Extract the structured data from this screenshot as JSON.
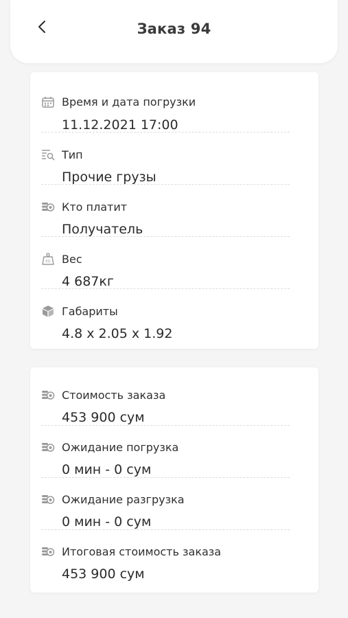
{
  "header": {
    "title": "Заказ 94",
    "back_icon": "chevron-left-icon"
  },
  "details": [
    {
      "icon": "calendar-icon",
      "label": "Время и дата погрузки",
      "value": "11.12.2021 17:00"
    },
    {
      "icon": "list-search-icon",
      "label": "Тип",
      "value": "Прочие грузы"
    },
    {
      "icon": "coins-icon",
      "label": "Кто платит",
      "value": "Получатель"
    },
    {
      "icon": "weight-icon",
      "label": "Вес",
      "value": "4 687кг"
    },
    {
      "icon": "box-icon",
      "label": "Габариты",
      "value": "4.8 x 2.05 x 1.92"
    }
  ],
  "costs": [
    {
      "icon": "coins-icon",
      "label": "Стоимость заказа",
      "value": "453 900 сум"
    },
    {
      "icon": "coins-icon",
      "label": "Ожидание погрузка",
      "value": "0 мин - 0 сум"
    },
    {
      "icon": "coins-icon",
      "label": "Ожидание разгрузка",
      "value": "0 мин - 0 сум"
    },
    {
      "icon": "coins-icon",
      "label": "Итоговая стоимость заказа",
      "value": "453 900 сум"
    }
  ]
}
